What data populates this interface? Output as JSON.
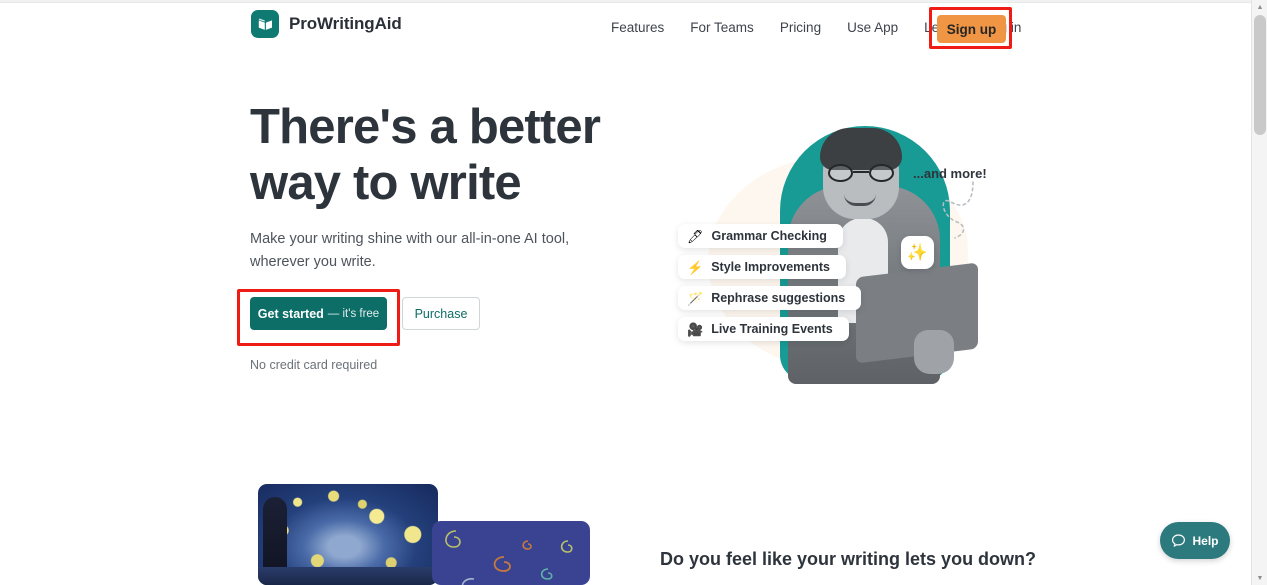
{
  "brand": {
    "name": "ProWritingAid",
    "logo_icon": "open-book-icon",
    "logo_color": "#0f7a72"
  },
  "nav": {
    "links": [
      {
        "label": "Features"
      },
      {
        "label": "For Teams"
      },
      {
        "label": "Pricing"
      },
      {
        "label": "Use App"
      },
      {
        "label": "Learn"
      },
      {
        "label": "Log in"
      }
    ],
    "signup_label": "Sign up",
    "signup_color": "#ef9544",
    "highlight_color": "#ee1c14"
  },
  "hero": {
    "title_line1": "There's a better",
    "title_line2": "way to write",
    "subtitle": "Make your writing shine with our all-in-one AI tool, wherever you write.",
    "primary_cta": "Get started",
    "primary_cta_suffix": "— it's free",
    "primary_cta_color": "#0d6d67",
    "secondary_cta": "Purchase",
    "footnote": "No credit card required"
  },
  "illustration": {
    "and_more_label": "...and more!",
    "sparkle_icon": "sparkles-icon",
    "chips": [
      {
        "icon": "pen-icon",
        "glyph": "🖊",
        "label": "Grammar Checking"
      },
      {
        "icon": "lightning-icon",
        "glyph": "⚡",
        "label": "Style Improvements"
      },
      {
        "icon": "magic-wand-icon",
        "glyph": "🪄",
        "label": "Rephrase suggestions"
      },
      {
        "icon": "video-camera-icon",
        "glyph": "🎥",
        "label": "Live Training Events"
      }
    ]
  },
  "bottom": {
    "heading": "Do you feel like your writing lets you down?",
    "artwork_left": "starry-night-painting",
    "artwork_right": "blue-swirl-card"
  },
  "help": {
    "label": "Help",
    "icon": "chat-bubble-icon",
    "color": "#2c7a7e"
  },
  "scrollbar": {
    "up_arrow": "▲",
    "down_arrow": "▼"
  }
}
